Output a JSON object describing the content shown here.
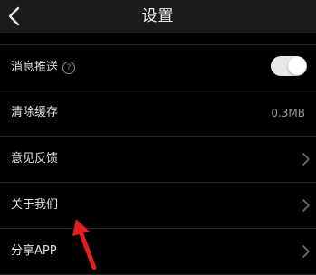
{
  "header": {
    "title": "设置"
  },
  "settings": [
    {
      "label": "消息推送",
      "help_icon": "?",
      "control": "toggle",
      "enabled": true
    },
    {
      "label": "清除缓存",
      "value": "0.3MB"
    },
    {
      "label": "意见反馈",
      "control": "chevron"
    },
    {
      "label": "关于我们",
      "control": "chevron"
    },
    {
      "label": "分享APP",
      "control": "chevron"
    }
  ],
  "colors": {
    "background": "#000000",
    "header": "#1b1b1b",
    "toggle_on": "#e8e8e8",
    "annotation_arrow": "#e01f1f"
  },
  "icons": [
    "back-arrow-icon",
    "help-icon",
    "chevron-right-icon",
    "red-annotation-arrow"
  ]
}
